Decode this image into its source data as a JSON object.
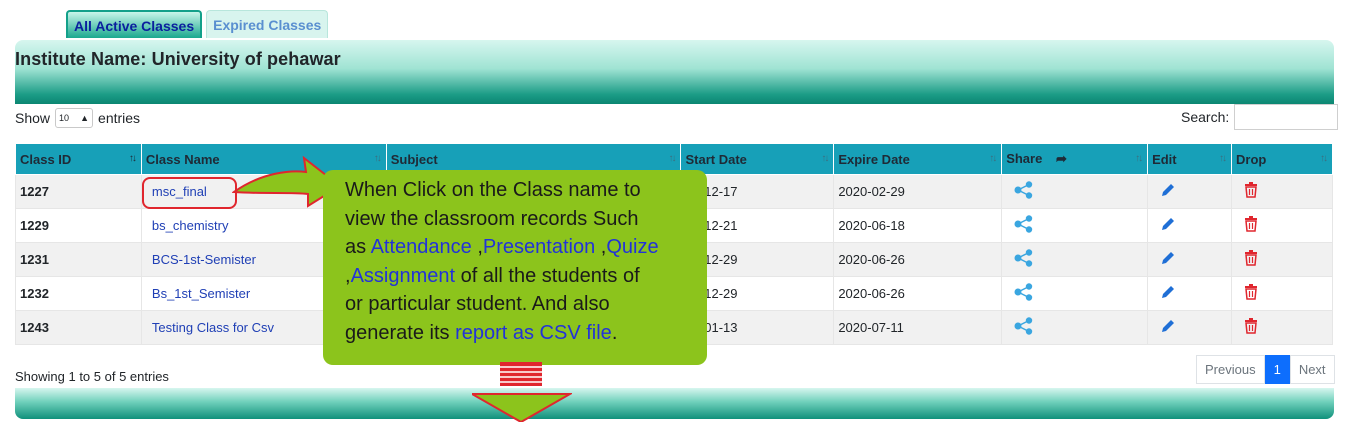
{
  "tabs": {
    "active": "All Active Classes",
    "expired": "Expired Classes"
  },
  "institute_title": "Institute Name: University of pehawar",
  "length": {
    "show": "Show",
    "value": "10",
    "entries": "entries"
  },
  "search": {
    "label": "Search:"
  },
  "columns": [
    "Class ID",
    "Class Name",
    "Subject",
    "Start Date",
    "Expire Date",
    "Share",
    "Edit",
    "Drop"
  ],
  "rows": [
    {
      "id": "1227",
      "name": "msc_final",
      "start": "19-12-17",
      "expire": "2020-02-29"
    },
    {
      "id": "1229",
      "name": "bs_chemistry",
      "start": "19-12-21",
      "expire": "2020-06-18"
    },
    {
      "id": "1231",
      "name": "BCS-1st-Semister",
      "start": "19-12-29",
      "expire": "2020-06-26"
    },
    {
      "id": "1232",
      "name": "Bs_1st_Semister",
      "start": "19-12-29",
      "expire": "2020-06-26"
    },
    {
      "id": "1243",
      "name": "Testing Class for Csv",
      "start": "20-01-13",
      "expire": "2020-07-11"
    }
  ],
  "info": "Showing 1 to 5 of 5 entries",
  "pagination": {
    "previous": "Previous",
    "current": "1",
    "next": "Next"
  },
  "callout": {
    "l1": "When Click on the Class name to",
    "l2": "view the classroom records  Such",
    "l3a": "as ",
    "attendance": "Attendance",
    "l3b": " ,",
    "presentation": "Presentation",
    "l3c": " ,",
    "quize": "Quize",
    "l4a": ",",
    "assignment": "Assignment",
    "l4b": " of all the students of",
    "l5": "or particular student. And also",
    "l6a": " generate its ",
    "report": "report as CSV file",
    "l6b": "."
  },
  "colors": {
    "header": "#17a0b8",
    "callout": "#8cc41c",
    "link": "#1f3fb5"
  }
}
